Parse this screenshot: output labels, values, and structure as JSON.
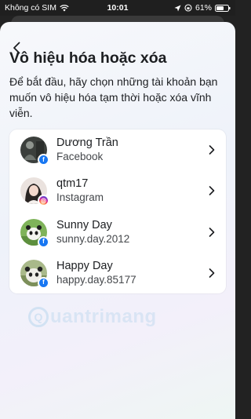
{
  "status_bar": {
    "carrier": "Không có SIM",
    "time": "10:01",
    "battery": "61%"
  },
  "header": {
    "back_icon": "chevron-left-icon",
    "title": "Vô hiệu hóa hoặc xóa",
    "description": "Để bắt đầu, hãy chọn những tài khoản bạn muốn vô hiệu hóa tạm thời hoặc xóa vĩnh viễn."
  },
  "accounts": [
    {
      "name": "Dương Trần",
      "platform": "Facebook",
      "badge": "f",
      "badge_icon": "facebook-icon"
    },
    {
      "name": "qtm17",
      "platform": "Instagram",
      "badge": "◎",
      "badge_icon": "instagram-icon"
    },
    {
      "name": "Sunny Day",
      "platform": "sunny.day.2012",
      "badge": "f",
      "badge_icon": "facebook-icon"
    },
    {
      "name": "Happy Day",
      "platform": "happy.day.85177",
      "badge": "f",
      "badge_icon": "facebook-icon"
    }
  ],
  "watermark": {
    "mark": "Q",
    "text": "uantrimang"
  },
  "colors": {
    "facebook": "#1877f2",
    "text_primary": "#1c1e21"
  }
}
